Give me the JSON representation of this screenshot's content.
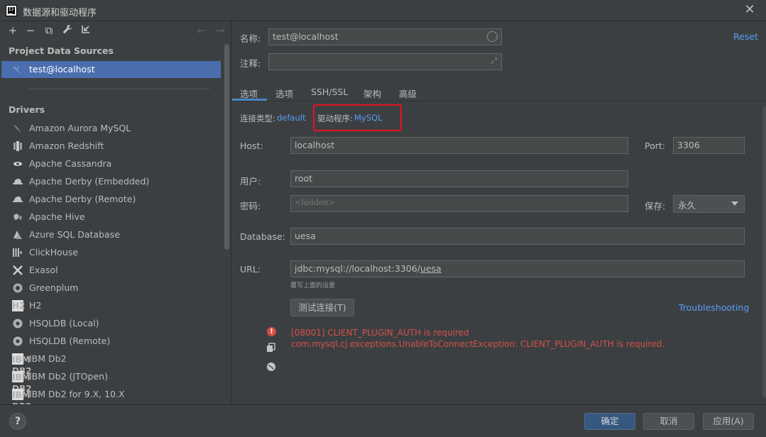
{
  "window": {
    "title": "数据源和驱动程序",
    "app_icon_text": "IJ"
  },
  "left": {
    "toolbar": {
      "add": "+",
      "remove": "−",
      "duplicate": "⧉",
      "settings": "🔧",
      "import": "⇱",
      "back": "←",
      "forward": "→"
    },
    "project_section_title": "Project Data Sources",
    "data_sources": [
      {
        "label": "test@localhost"
      }
    ],
    "drivers_section_title": "Drivers",
    "drivers": [
      {
        "label": "Amazon Aurora MySQL",
        "icon": "dolphin-icon"
      },
      {
        "label": "Amazon Redshift",
        "icon": "redshift-icon"
      },
      {
        "label": "Apache Cassandra",
        "icon": "eye-icon"
      },
      {
        "label": "Apache Derby (Embedded)",
        "icon": "derby-hat-icon"
      },
      {
        "label": "Apache Derby (Remote)",
        "icon": "derby-hat-icon"
      },
      {
        "label": "Apache Hive",
        "icon": "hive-bee-icon"
      },
      {
        "label": "Azure SQL Database",
        "icon": "azure-triangle-icon"
      },
      {
        "label": "ClickHouse",
        "icon": "bars-icon"
      },
      {
        "label": "Exasol",
        "icon": "x-icon"
      },
      {
        "label": "Greenplum",
        "icon": "circle-icon"
      },
      {
        "label": "H2",
        "icon": "h2-icon"
      },
      {
        "label": "HSQLDB (Local)",
        "icon": "hsqldb-icon"
      },
      {
        "label": "HSQLDB (Remote)",
        "icon": "hsqldb-icon"
      },
      {
        "label": "IBM Db2",
        "icon": "ibm-db2-icon"
      },
      {
        "label": "IBM Db2 (JTOpen)",
        "icon": "ibm-db2-icon"
      },
      {
        "label": "IBM Db2 for 9.X, 10.X",
        "icon": "ibm-db2-icon"
      }
    ],
    "ibm_icon_text_1": "IBM",
    "ibm_icon_text_2": "DB2",
    "h2_icon_text": "H2"
  },
  "form": {
    "name_label": "名称:",
    "name_value": "test@localhost",
    "comment_label": "注释:",
    "comment_value": "",
    "reset_link": "Reset",
    "tabs": [
      {
        "label": "选项"
      },
      {
        "label": "选项"
      },
      {
        "label": "SSH/SSL"
      },
      {
        "label": "架构"
      },
      {
        "label": "高级"
      }
    ],
    "connection_type_label": "连接类型:",
    "connection_type_value": "default",
    "driver_label": "驱动程序:",
    "driver_value": "MySQL",
    "host_label": "Host:",
    "host_value": "localhost",
    "port_label": "Port:",
    "port_value": "3306",
    "user_label": "用户:",
    "user_value": "root",
    "password_label": "密码:",
    "password_placeholder": "<hidden>",
    "save_label": "保存:",
    "save_value": "永久",
    "database_label": "Database:",
    "database_value": "uesa",
    "url_label": "URL:",
    "url_value_prefix": "jdbc:mysql://localhost:3306/",
    "url_value_db": "uesa",
    "url_hint": "覆写上面的设置",
    "test_button": "测试连接(T)",
    "troubleshooting_link": "Troubleshooting",
    "error_line_1": "[08001] CLIENT_PLUGIN_AUTH is required",
    "error_line_2": "com.mysql.cj.exceptions.UnableToConnectException: CLIENT_PLUGIN_AUTH is required."
  },
  "footer": {
    "help": "?",
    "ok": "确定",
    "cancel": "取消",
    "apply": "应用(A)"
  },
  "colors": {
    "accent_selection": "#4b6eaf",
    "link": "#589df6",
    "error": "#d3514a",
    "highlight_box": "#e81123"
  }
}
